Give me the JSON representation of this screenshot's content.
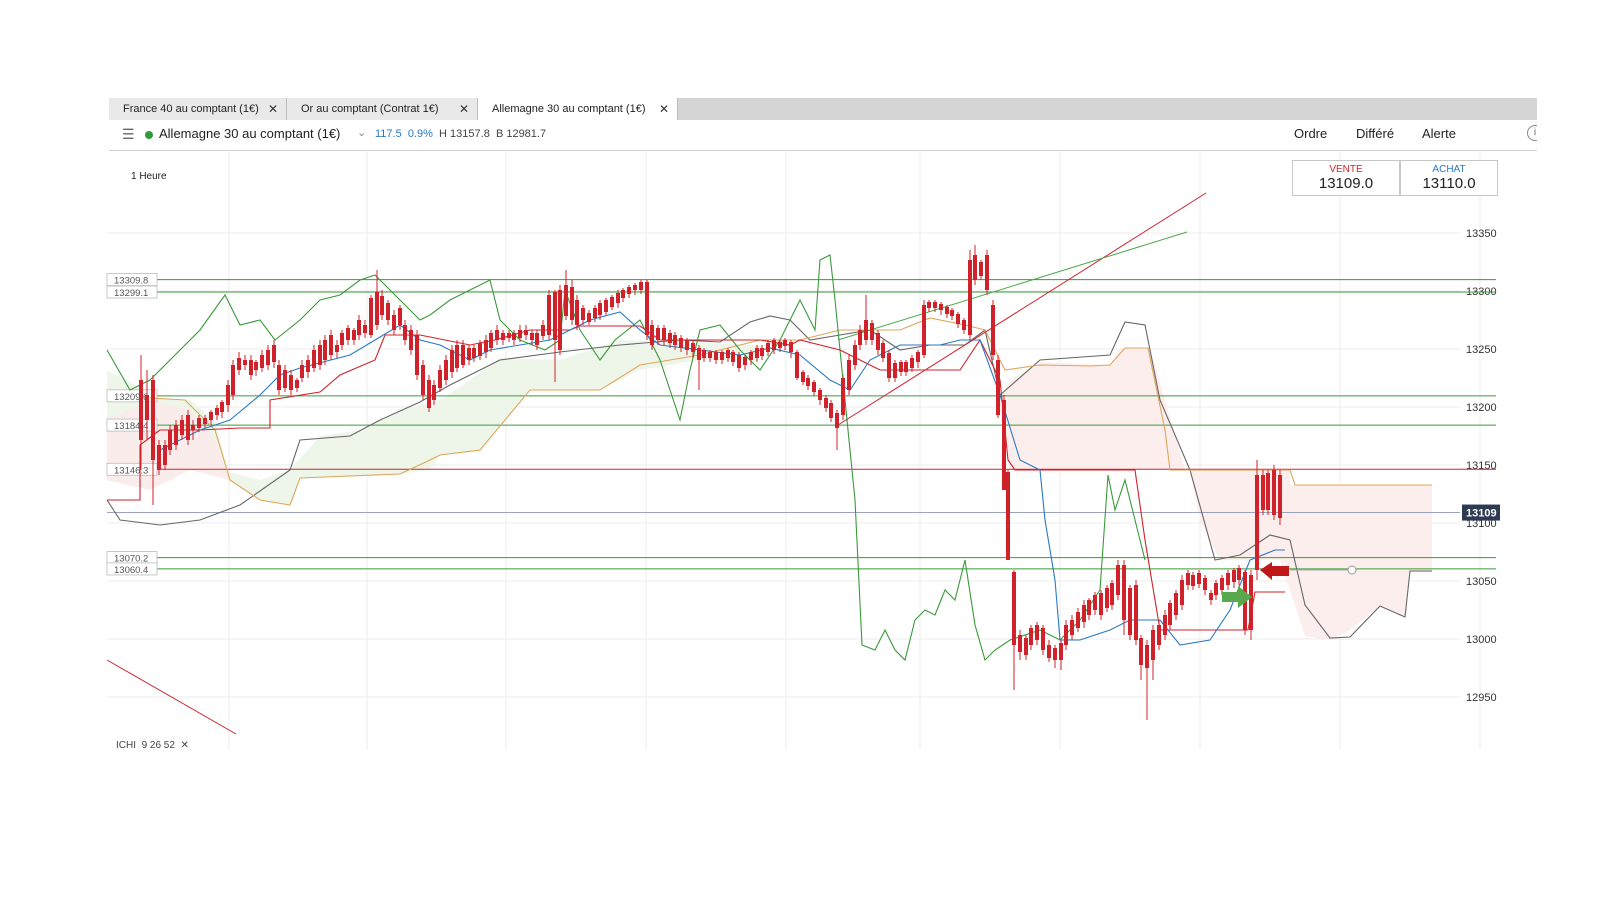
{
  "tabs": [
    {
      "label": "France 40 au comptant (1€)",
      "close": "✕"
    },
    {
      "label": "Or au comptant (Contrat 1€)",
      "close": "✕"
    },
    {
      "label": "Allemagne 30 au comptant (1€)",
      "close": "✕",
      "active": true
    }
  ],
  "header": {
    "menu_icon": "☰",
    "instrument": "Allemagne 30 au comptant (1€)",
    "change": "117.5",
    "change_pct": "0.9%",
    "high": "H 13157.8",
    "low": "B 12981.7",
    "buttons": [
      "Ordre",
      "Différé",
      "Alerte"
    ],
    "info_icon": "i"
  },
  "timeframe": "1 Heure",
  "quote": {
    "sell_label": "VENTE",
    "sell_value": "13109.0",
    "buy_label": "ACHAT",
    "buy_value": "13110.0",
    "sell_color": "#d0222a",
    "buy_color": "#2a79c4"
  },
  "indicator": {
    "label": "ICHI",
    "params": "9  26  52",
    "close": "✕"
  },
  "chart_data": {
    "type": "candlestick",
    "instrument": "Allemagne 30 au comptant (1€)",
    "timeframe": "1 Heure",
    "y_ticks": [
      "13350",
      "13300",
      "13250",
      "13200",
      "13150",
      "13100",
      "13050",
      "13000",
      "12950"
    ],
    "current_price": "13109",
    "level_labels": [
      {
        "value": 13309.8,
        "label": "13309.8",
        "color": "#3a9a3a"
      },
      {
        "value": 13299.1,
        "label": "13299.1",
        "color": "#3a9a3a"
      },
      {
        "value": 13209.6,
        "label": "13209.6",
        "color": "#3a9a3a"
      },
      {
        "value": 13184.4,
        "label": "13184.4",
        "color": "#3a9a3a"
      },
      {
        "value": 13146.3,
        "label": "13146.3",
        "color": "#d0222a"
      },
      {
        "value": 13070.2,
        "label": "13070.2",
        "color": "#3a9a3a"
      },
      {
        "value": 13060.4,
        "label": "13060.4",
        "color": "#3a9a3a"
      }
    ],
    "colors": {
      "up": "#2e9b3c",
      "down": "#d0222a",
      "tenkan": "#d0222a",
      "kijun": "#2a79c4",
      "chikou": "#3a9a3a",
      "senkou_a": "#e0a55a",
      "senkou_b": "#666666"
    }
  }
}
